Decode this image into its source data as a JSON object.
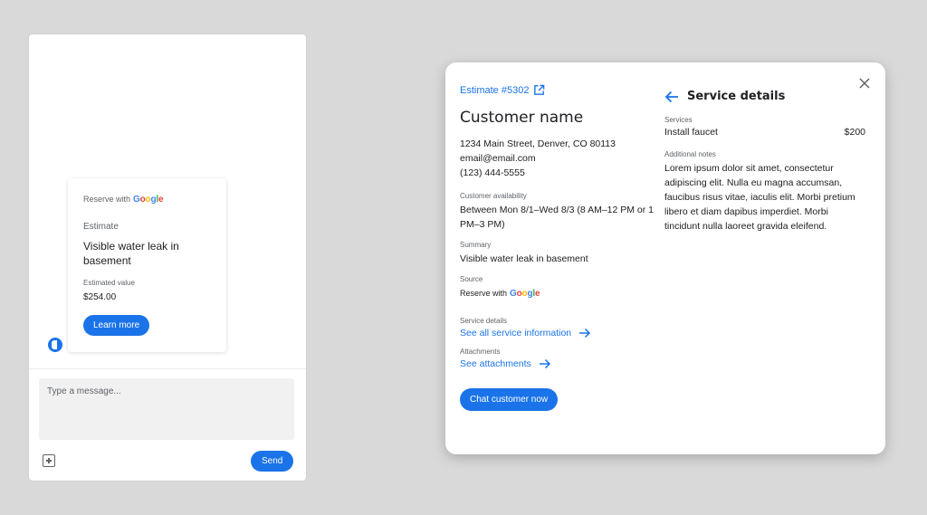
{
  "chat": {
    "card": {
      "reserve_with": "Reserve with",
      "google": [
        "G",
        "o",
        "o",
        "g",
        "l",
        "e"
      ],
      "type": "Estimate",
      "title": "Visible water leak in basement",
      "value_label": "Estimated value",
      "value": "$254.00",
      "button_label": "Learn more"
    },
    "input": {
      "placeholder": "Type a message..."
    },
    "send_label": "Send",
    "icons": {
      "avatar": "bot-avatar-icon",
      "attach": "add-box-icon"
    }
  },
  "dialog": {
    "estimate_link": "Estimate #5302",
    "customer_name": "Customer name",
    "address": "1234 Main Street, Denver, CO 80113",
    "email": "email@email.com",
    "phone": "(123) 444-5555",
    "availability_label": "Customer availability",
    "availability": "Between Mon 8/1–Wed 8/3 (8 AM–12 PM or 1 PM–3 PM)",
    "summary_label": "Summary",
    "summary": "Visible water leak in basement",
    "source_label": "Source",
    "source_reserve": "Reserve with",
    "service_details_label": "Service details",
    "service_details_link": "See all service information",
    "attachments_label": "Attachments",
    "attachments_link": "See attachments",
    "chat_button": "Chat customer now",
    "services_panel": {
      "title": "Service details",
      "services_label": "Services",
      "service_name": "Install faucet",
      "service_price": "$200",
      "notes_label": "Additional notes",
      "notes": "Lorem ipsum dolor sit amet, consectetur adipiscing elit. Nulla eu magna accumsan, faucibus risus vitae, iaculis elit. Morbi pretium libero et diam dapibus imperdiet. Morbi tincidunt nulla laoreet gravida eleifend."
    }
  },
  "colors": {
    "accent": "#1a73e8",
    "google_blue": "#4285f4",
    "google_red": "#ea4335",
    "google_yellow": "#fbbc05",
    "google_green": "#34a853"
  }
}
